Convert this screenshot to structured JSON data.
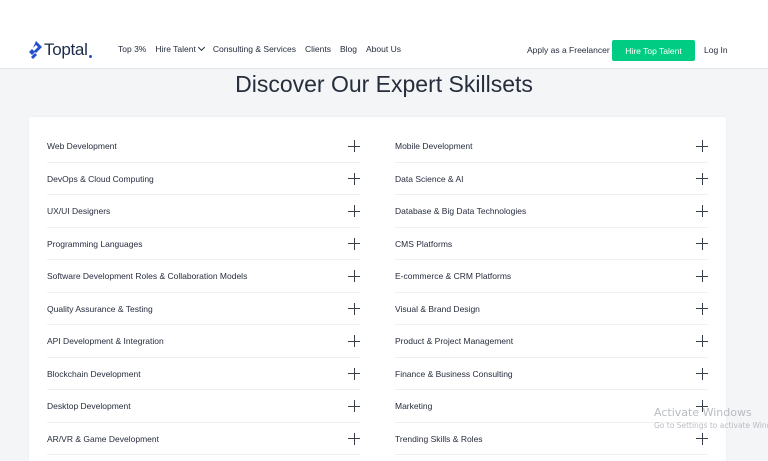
{
  "header": {
    "logo_text": "Toptal",
    "nav": [
      "Top 3%",
      "Hire Talent",
      "Consulting & Services",
      "Clients",
      "Blog",
      "About Us"
    ],
    "apply": "Apply as a Freelancer",
    "hire_button": "Hire Top Talent",
    "login": "Log In"
  },
  "main": {
    "title": "Discover Our Expert Skillsets",
    "left_items": [
      "Web Development",
      "DevOps & Cloud Computing",
      "UX/UI Designers",
      "Programming Languages",
      "Software Development Roles & Collaboration Models",
      "Quality Assurance & Testing",
      "API Development & Integration",
      "Blockchain Development",
      "Desktop Development",
      "AR/VR & Game Development"
    ],
    "right_items": [
      "Mobile Development",
      "Data Science & AI",
      "Database & Big Data Technologies",
      "CMS Platforms",
      "E-commerce & CRM Platforms",
      "Visual & Brand Design",
      "Product & Project Management",
      "Finance & Business Consulting",
      "Marketing",
      "Trending Skills & Roles"
    ]
  },
  "watermark": {
    "title": "Activate Windows",
    "subtitle": "Go to Settings to activate Windows."
  },
  "colors": {
    "brand_blue": "#204ecf",
    "accent_green": "#00cc83",
    "text_dark": "#262d3d",
    "background": "#f4f5f7"
  },
  "icons": {
    "logo": "toptal-logo-icon",
    "expand": "plus-icon",
    "dropdown": "chevron-down-icon"
  }
}
